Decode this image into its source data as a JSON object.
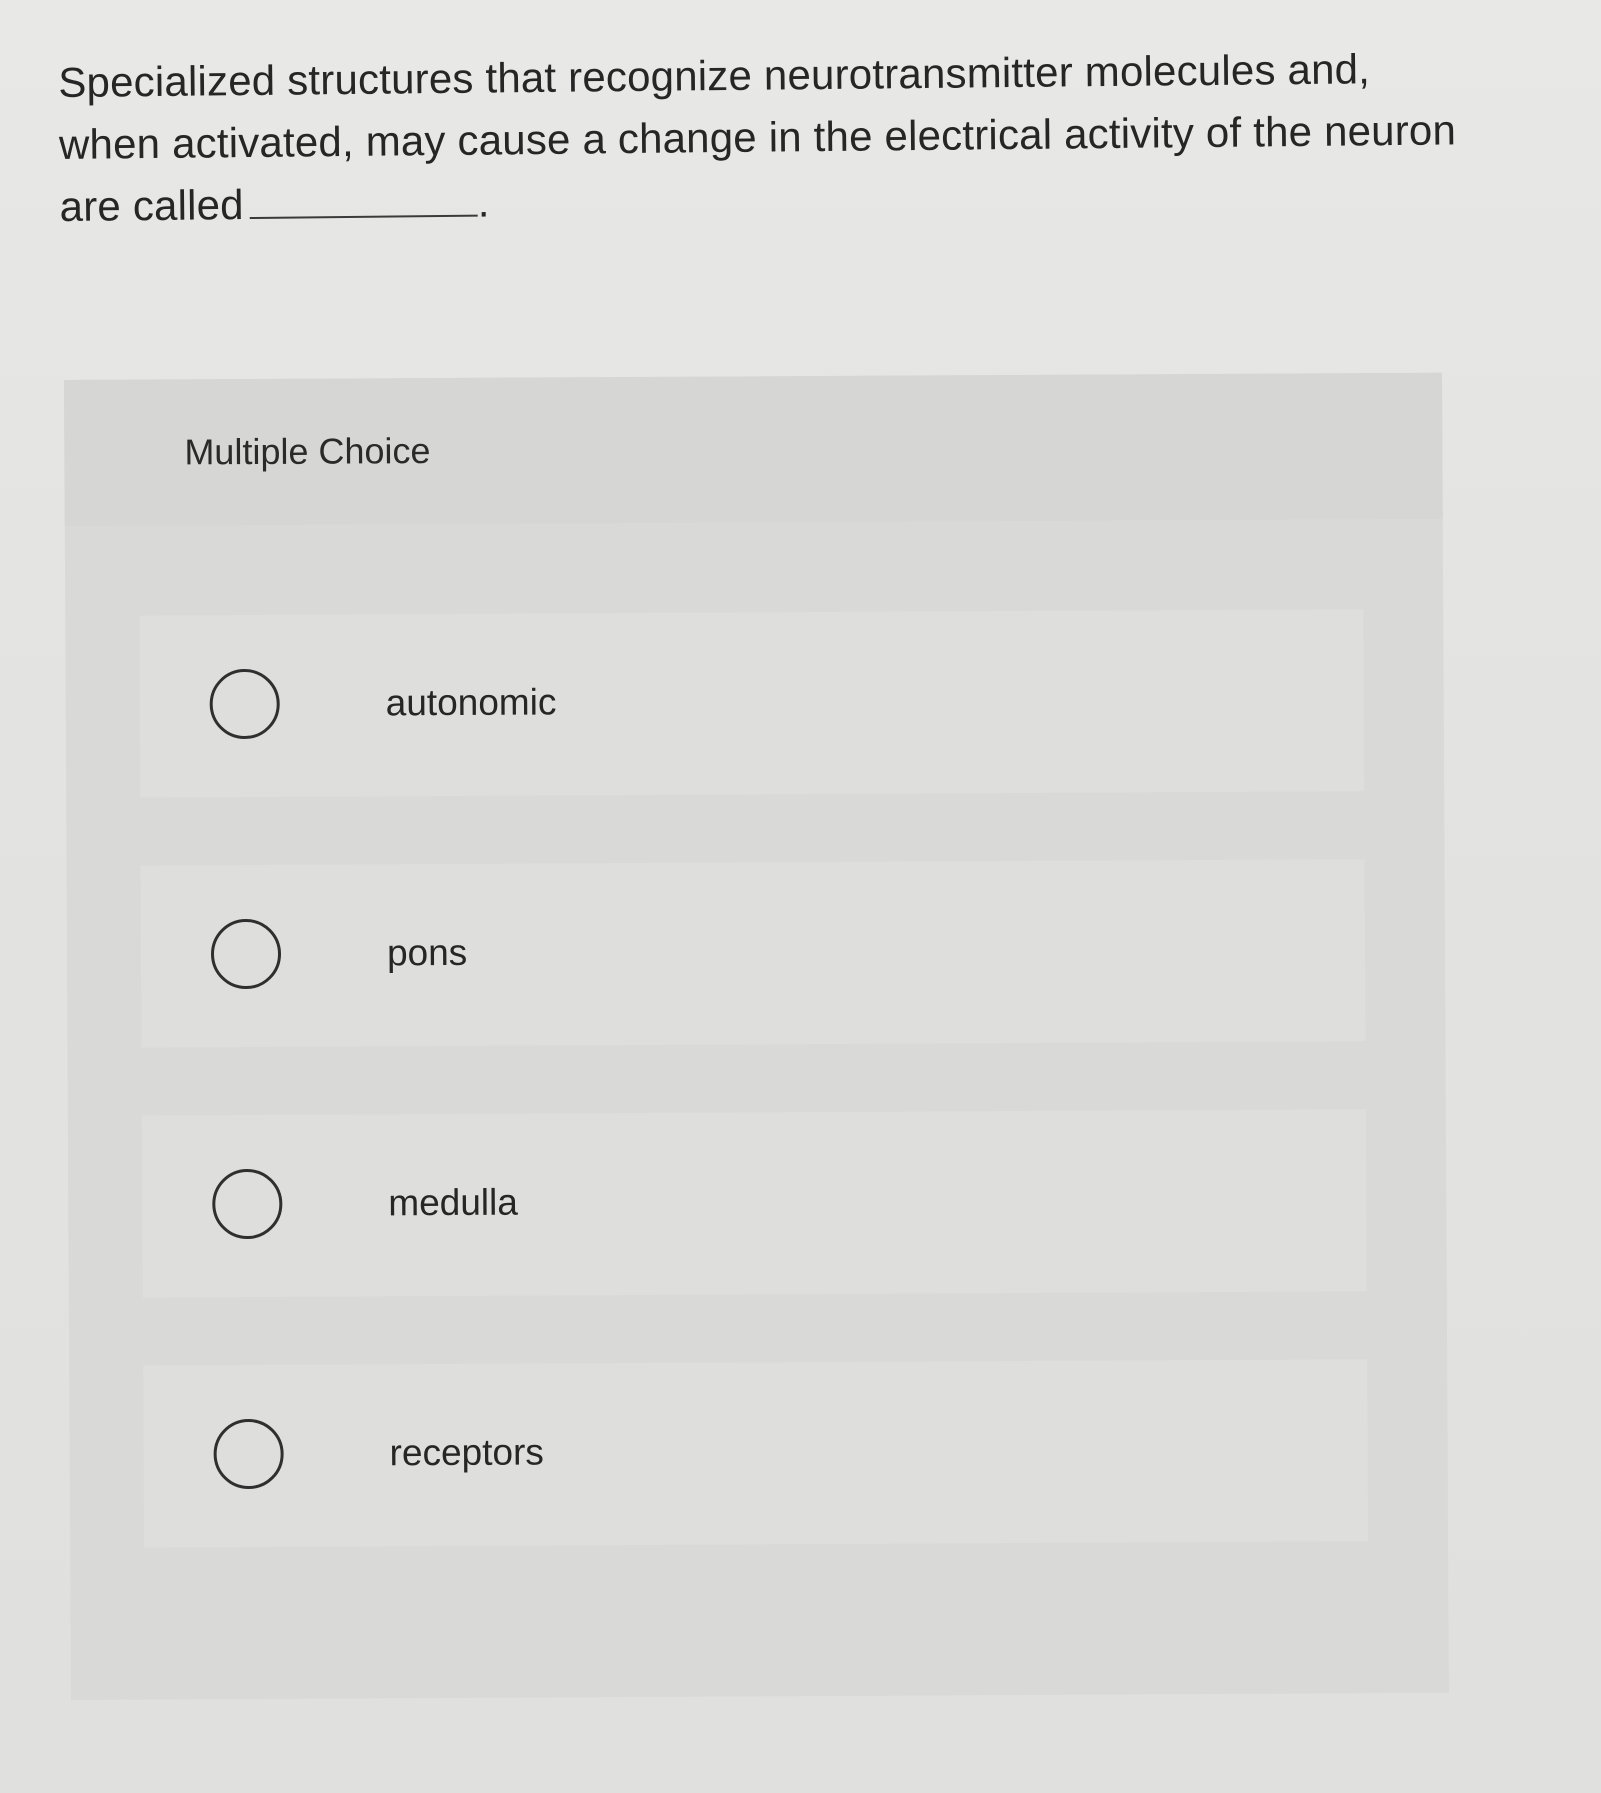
{
  "question": {
    "text": "Specialized structures that recognize neurotransmitter molecules and, when activated, may cause a change in the electrical activity of the neuron are called",
    "blank_suffix": "."
  },
  "panel": {
    "title": "Multiple Choice"
  },
  "options": [
    {
      "label": "autonomic"
    },
    {
      "label": "pons"
    },
    {
      "label": "medulla"
    },
    {
      "label": "receptors"
    }
  ]
}
